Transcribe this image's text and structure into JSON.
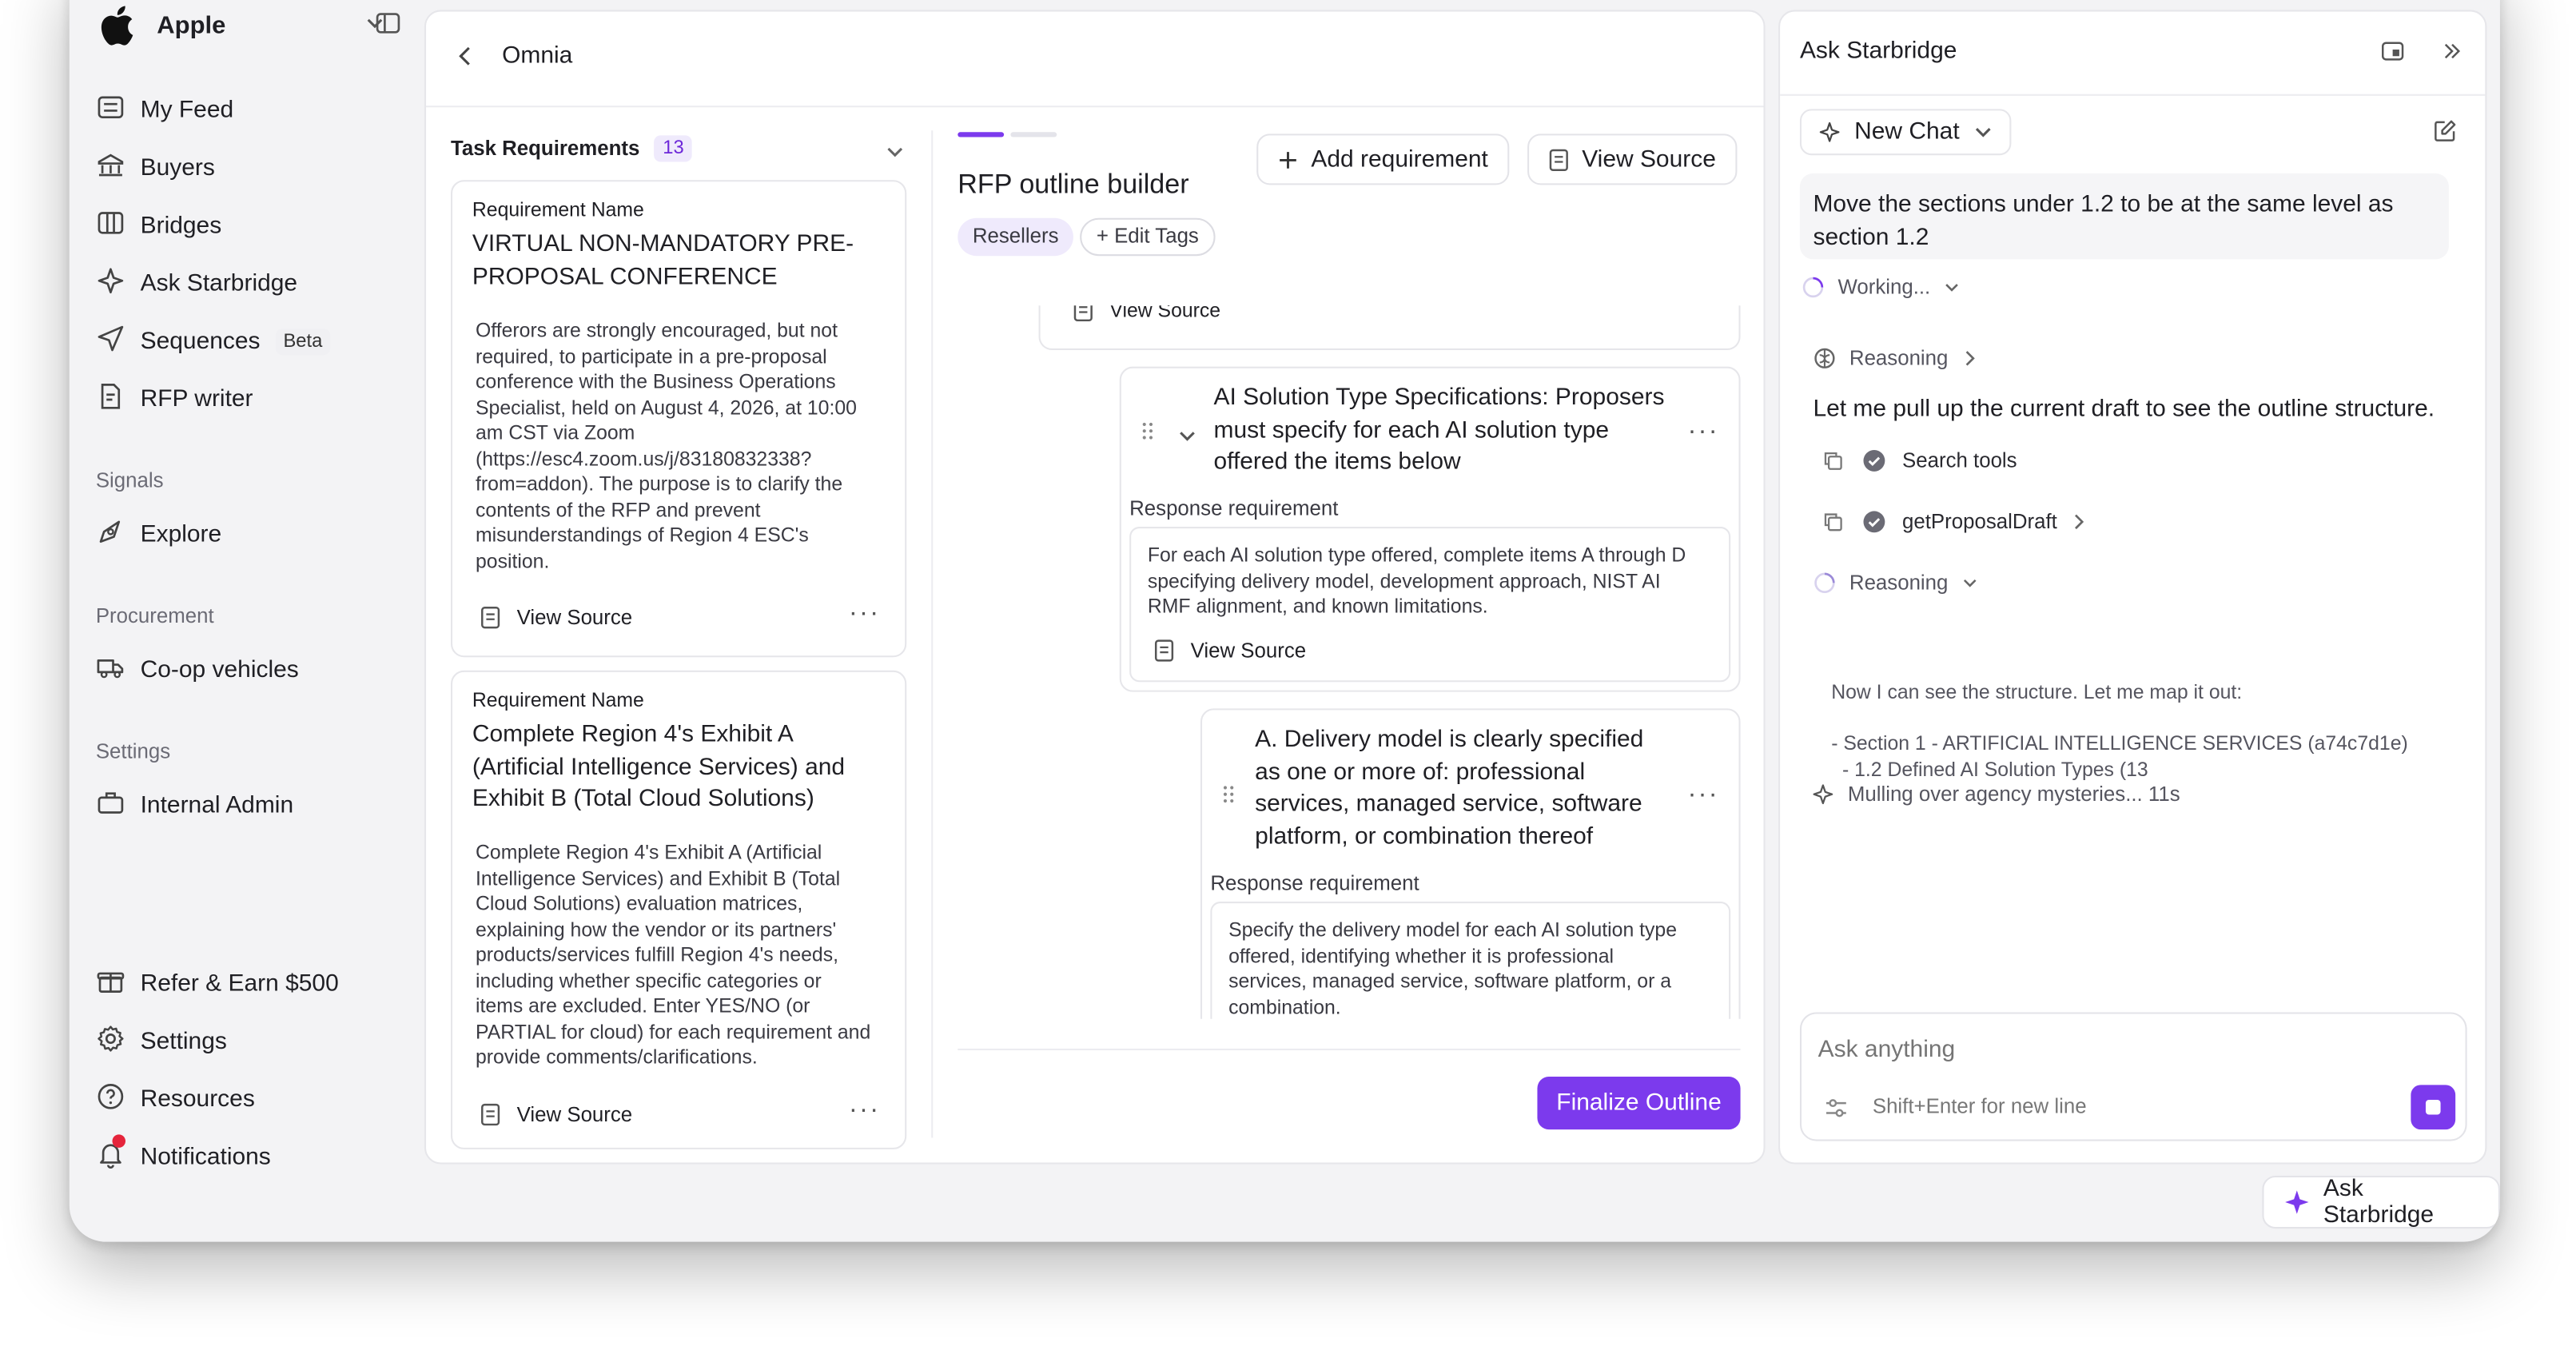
{
  "workspace": {
    "name": "Apple"
  },
  "sidebar": {
    "items": [
      {
        "label": "My Feed"
      },
      {
        "label": "Buyers"
      },
      {
        "label": "Bridges"
      },
      {
        "label": "Ask Starbridge"
      },
      {
        "label": "Sequences",
        "badge": "Beta"
      },
      {
        "label": "RFP writer"
      }
    ],
    "signals": {
      "heading": "Signals",
      "items": [
        {
          "label": "Explore"
        }
      ]
    },
    "procurement": {
      "heading": "Procurement",
      "items": [
        {
          "label": "Co-op vehicles"
        }
      ]
    },
    "settings": {
      "heading": "Settings",
      "items": [
        {
          "label": "Internal Admin"
        }
      ]
    },
    "bottom": [
      {
        "label": "Refer & Earn $500"
      },
      {
        "label": "Settings"
      },
      {
        "label": "Resources"
      },
      {
        "label": "Notifications"
      }
    ]
  },
  "header": {
    "title": "Omnia"
  },
  "requirements": {
    "title": "Task Requirements",
    "count": "13",
    "cards": [
      {
        "label": "Requirement Name",
        "name": "VIRTUAL NON-MANDATORY PRE-PROPOSAL CONFERENCE",
        "lines": [
          "Offerors are strongly encouraged, but not",
          "required, to participate in a pre-proposal",
          "conference with the Business Operations",
          "Specialist, held on August 4, 2026, at 10:00",
          "am CST via Zoom",
          "(https://esc4.zoom.us/j/83180832338?",
          "from=addon). The purpose is to clarify the",
          "contents of the RFP and prevent",
          "misunderstandings of Region 4 ESC's",
          "position."
        ],
        "view_source": "View Source"
      },
      {
        "label": "Requirement Name",
        "name_lines": [
          "Complete Region 4's Exhibit A",
          "(Artificial Intelligence Services) and",
          "Exhibit B (Total Cloud Solutions)"
        ],
        "lines": [
          "Complete Region 4's Exhibit A (Artificial",
          "Intelligence Services) and Exhibit B (Total",
          "Cloud Solutions) evaluation matrices,",
          "explaining how the vendor or its partners'",
          "products/services fulfill Region 4's needs,",
          "including whether specific categories or",
          "items are excluded. Enter YES/NO (or",
          "PARTIAL for cloud) for each requirement and",
          "provide comments/clarifications."
        ],
        "view_source": "View Source"
      }
    ]
  },
  "builder": {
    "title": "RFP outline builder",
    "tag": "Resellers",
    "edit_tags": "+ Edit Tags",
    "add_requirement": "Add requirement",
    "view_source": "View Source",
    "partial_view_source": "View Source",
    "section1": {
      "title_lines": [
        "AI Solution Type Specifications: Proposers",
        "must specify for each AI solution type",
        "offered the items below"
      ],
      "resp_label": "Response requirement",
      "resp_lines": [
        "For each AI solution type offered, complete items A through D",
        "specifying delivery model, development approach, NIST AI",
        "RMF alignment, and known limitations."
      ],
      "view_source": "View Source"
    },
    "section2": {
      "title_lines": [
        "A. Delivery model is clearly specified",
        "as one or more of: professional",
        "services, managed service, software",
        "platform, or combination thereof"
      ],
      "resp_label": "Response requirement",
      "resp_lines": [
        "Specify the delivery model for each AI solution type",
        "offered, identifying whether it is professional",
        "services, managed service, software platform, or a",
        "combination."
      ]
    },
    "finalize": "Finalize Outline"
  },
  "chat": {
    "title": "Ask Starbridge",
    "new_chat": "New Chat",
    "user_message_lines": [
      "Move the sections under 1.2 to be at the same level as",
      "section 1.2"
    ],
    "working": "Working...",
    "reasoning1": "Reasoning",
    "reply": "Let me pull up the current draft to see the outline structure.",
    "tool1": "Search tools",
    "tool2": "getProposalDraft",
    "reasoning2": "Reasoning",
    "thought_lines": [
      "Now I can see the structure. Let me map it out:",
      "",
      "- Section 1 - ARTIFICIAL INTELLIGENCE SERVICES (a74c7d1e)",
      "  - 1.2 Defined AI Solution Types (13"
    ],
    "mulling": "Mulling over agency mysteries... 11s",
    "input_placeholder": "Ask anything",
    "hint": "Shift+Enter for new line",
    "fab": "Ask Starbridge"
  },
  "colors": {
    "accent": "#7c3aed",
    "tag_bg": "#efeafc"
  }
}
